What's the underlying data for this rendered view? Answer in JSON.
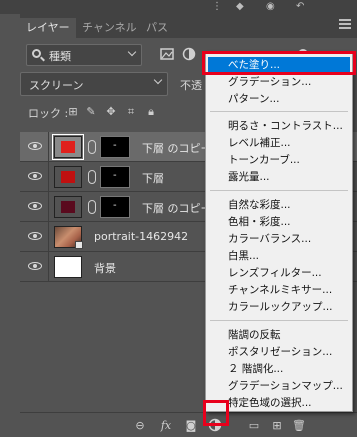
{
  "panel": {
    "tabs": [
      "レイヤー",
      "チャンネル",
      "パス"
    ],
    "active_tab": 0
  },
  "filter": {
    "kind_label": "種類"
  },
  "blend": {
    "mode": "スクリーン",
    "opacity_label": "不透"
  },
  "lock": {
    "label": "ロック :"
  },
  "layers": [
    {
      "name": "下層 のコピー",
      "thumb_color": "#e0201c",
      "mask_text": "-",
      "selected": true
    },
    {
      "name": "下層",
      "thumb_color": "#c01010",
      "mask_text": "-",
      "selected": false
    },
    {
      "name": "下層 のコピー",
      "thumb_color": "#5a0a1e",
      "mask_text": "-",
      "selected": false
    },
    {
      "name": "portrait-1462942",
      "kind": "image",
      "selected": false
    },
    {
      "name": "背景",
      "kind": "background",
      "selected": false
    }
  ],
  "menu": {
    "group1": [
      "べた塗り...",
      "グラデーション...",
      "パターン..."
    ],
    "group2": [
      "明るさ・コントラスト...",
      "レベル補正...",
      "トーンカーブ...",
      "露光量..."
    ],
    "group3": [
      "自然な彩度...",
      "色相・彩度...",
      "カラーバランス...",
      "白黒...",
      "レンズフィルター...",
      "チャンネルミキサー...",
      "カラールックアップ..."
    ],
    "group4": [
      "階調の反転",
      "ポスタリゼーション...",
      "２ 階調化...",
      "グラデーションマップ...",
      "特定色域の選択..."
    ],
    "highlighted": "べた塗り..."
  },
  "colors": {
    "panel_bg": "#535353",
    "tab_bg": "#424242",
    "highlight": "#0078d7",
    "annotation_red": "#e8001c"
  },
  "icons": {
    "bottom": [
      "link-layers-icon",
      "fx-icon",
      "add-mask-icon",
      "adjustment-layer-icon",
      "folder-icon",
      "new-layer-icon",
      "trash-icon"
    ]
  }
}
